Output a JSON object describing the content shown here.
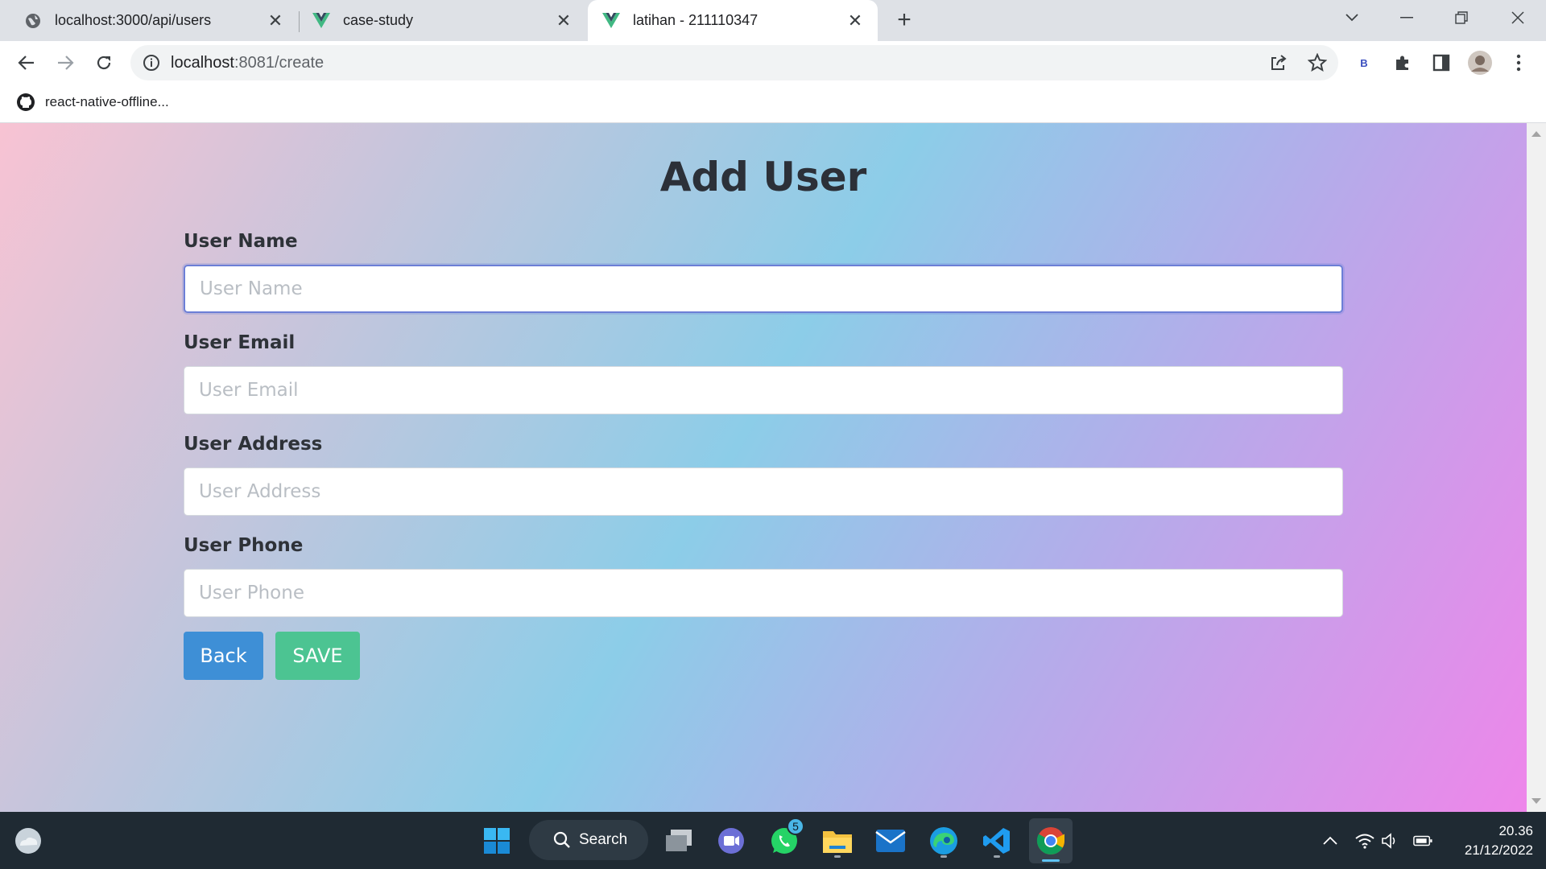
{
  "browser": {
    "tabs": [
      {
        "title": "localhost:3000/api/users",
        "favicon": "globe-icon"
      },
      {
        "title": "case-study",
        "favicon": "vue-icon"
      },
      {
        "title": "latihan - 211110347",
        "favicon": "vue-icon",
        "active": true
      }
    ],
    "url_host": "localhost",
    "url_rest": ":8081/create",
    "bookmark_label": "react-native-offline...",
    "extension_letter": "B"
  },
  "page": {
    "title": "Add User",
    "fields": [
      {
        "label": "User Name",
        "placeholder": "User Name",
        "value": ""
      },
      {
        "label": "User Email",
        "placeholder": "User Email",
        "value": ""
      },
      {
        "label": "User Address",
        "placeholder": "User Address",
        "value": ""
      },
      {
        "label": "User Phone",
        "placeholder": "User Phone",
        "value": ""
      }
    ],
    "back_label": "Back",
    "save_label": "SAVE",
    "colors": {
      "back": "#3e8fd6",
      "save": "#4cc492",
      "focus": "#6c7fd6"
    }
  },
  "taskbar": {
    "search_label": "Search",
    "whatsapp_badge": "5",
    "time": "20.36",
    "date": "21/12/2022"
  }
}
